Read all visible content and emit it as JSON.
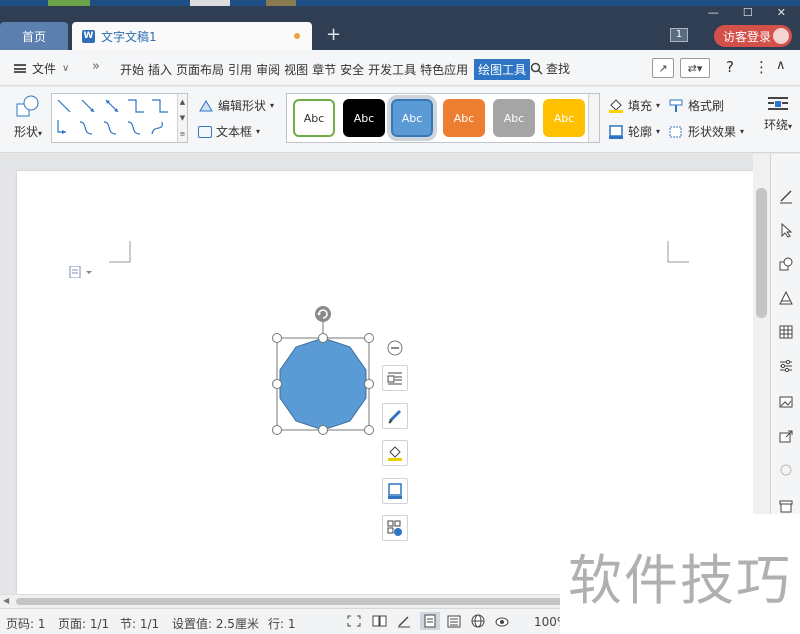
{
  "tabs": {
    "home": "首页",
    "document": "文字文稿1",
    "new_tab": "+"
  },
  "window": {
    "badge": "1",
    "login": "访客登录",
    "minimize": "—",
    "maximize": "☐",
    "close": "✕"
  },
  "menu": {
    "file": "文件",
    "file_arrow": "∨",
    "more": "»",
    "items": [
      "开始",
      "插入",
      "页面布局",
      "引用",
      "审阅",
      "视图",
      "章节",
      "安全",
      "开发工具",
      "特色应用"
    ],
    "active": "绘图工具",
    "search": "查找",
    "help": "?",
    "more_options": "⋮",
    "collapse": "∧"
  },
  "ribbon": {
    "shape": "形状",
    "edit_shape": "编辑形状",
    "text_box": "文本框",
    "style_label": "Abc",
    "style_colors": [
      "#ffffff",
      "#000000",
      "#5b9bd5",
      "#ed7d31",
      "#a5a5a5",
      "#ffc000"
    ],
    "fill": "填充",
    "outline": "轮廓",
    "format_painter": "格式刷",
    "shape_effect": "形状效果",
    "wrap": "环绕"
  },
  "shape": {
    "type": "decagon",
    "fill_color": "#5b9bd5"
  },
  "status": {
    "page_num": "页码: 1",
    "page_total": "页面: 1/1",
    "section": "节: 1/1",
    "setting": "设置值: 2.5厘米",
    "row": "行: 1",
    "zoom": "100%"
  },
  "watermark": "软件技巧"
}
